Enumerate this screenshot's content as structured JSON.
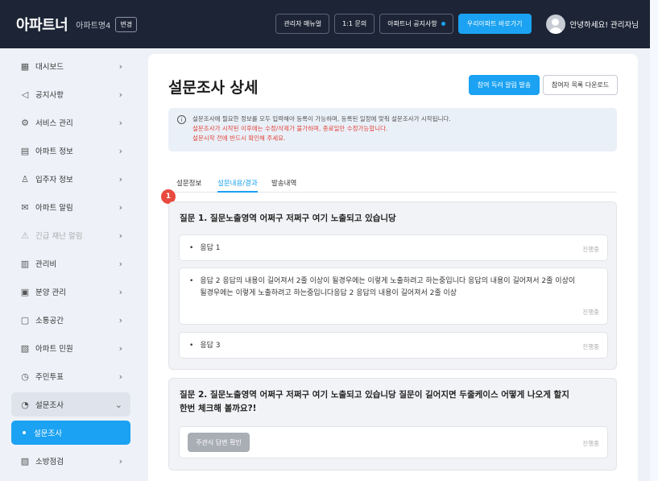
{
  "header": {
    "logo": "아파트너",
    "apt_name": "아파트명4",
    "change_label": "변경",
    "buttons": {
      "admin_manual": "관리자 매뉴얼",
      "inquiry": "1:1 문의",
      "notice": "아파트너 공지사항",
      "go_apt": "우리아파트 바로가기"
    },
    "greeting": "안녕하세요! 관리자님"
  },
  "sidebar": {
    "items": [
      {
        "label": "대시보드",
        "icon": "dashboard-icon"
      },
      {
        "label": "공지사항",
        "icon": "megaphone-icon"
      },
      {
        "label": "서비스 관리",
        "icon": "gear-icon"
      },
      {
        "label": "아파트 정보",
        "icon": "building-icon"
      },
      {
        "label": "입주자 정보",
        "icon": "person-icon"
      },
      {
        "label": "아파트 알림",
        "icon": "mail-icon"
      },
      {
        "label": "긴급 재난 알림",
        "icon": "alert-icon"
      },
      {
        "label": "관리비",
        "icon": "chart-icon"
      },
      {
        "label": "분양 관리",
        "icon": "calendar-icon"
      },
      {
        "label": "소통공간",
        "icon": "chat-icon"
      },
      {
        "label": "아파트 민원",
        "icon": "complaint-icon"
      },
      {
        "label": "주민투표",
        "icon": "vote-icon"
      },
      {
        "label": "설문조사",
        "icon": "survey-icon"
      },
      {
        "label": "설문조사",
        "icon": "bullet"
      },
      {
        "label": "소방점검",
        "icon": "fire-icon"
      }
    ]
  },
  "main": {
    "title": "설문조사 상세",
    "notify_button": "참여 독려 알림 발송",
    "download_button": "참여자 목록 다운로드",
    "info": {
      "line1": "설문조사에 필요한 정보를 모두 입력해야 등록이 가능하며, 등록된 일정에 맞춰 설문조사가 시작됩니다.",
      "line2": "설문조사가 시작된 이후에는 수정/삭제가 불가하며, 종료일만 수정가능합니다.",
      "line3": "설문시작 전에 반드시 확인해 주세요."
    },
    "tabs": [
      "설문정보",
      "설문내용/결과",
      "발송내역"
    ],
    "badge": "1",
    "questions": [
      {
        "title": "질문 1. 질문노출영역 어쩌구 저쩌구 여기 노출되고 있습니당",
        "answers": [
          {
            "text": "응답 1",
            "status": "진행중"
          },
          {
            "text": "응답 2 응답의 내용이 길어져서 2줄 이상이 될경우에는 이렇게 노출하려고 하는중입니다 응답의 내용이 길어져서 2줄 이상이 될경우에는 이렇게 노출하려고 하는중입니다응답 2 응답의 내용이 길어져서 2줄 이상",
            "status": "진행중"
          },
          {
            "text": "응답 3",
            "status": "진행중"
          }
        ]
      },
      {
        "title_line1": "질문 2. 질문노출영역 어쩌구 저쩌구 여기 노출되고 있습니당 질문이 길어지면 두줄케이스 어떻게 나오게 할지",
        "title_line2": "한번 체크해 볼까요?!",
        "subjective_button": "주관식 답변 확인",
        "status": "진행중"
      }
    ]
  },
  "colors": {
    "header_bg": "#1c2435",
    "accent": "#1ba2f2",
    "danger": "#e2463b"
  }
}
